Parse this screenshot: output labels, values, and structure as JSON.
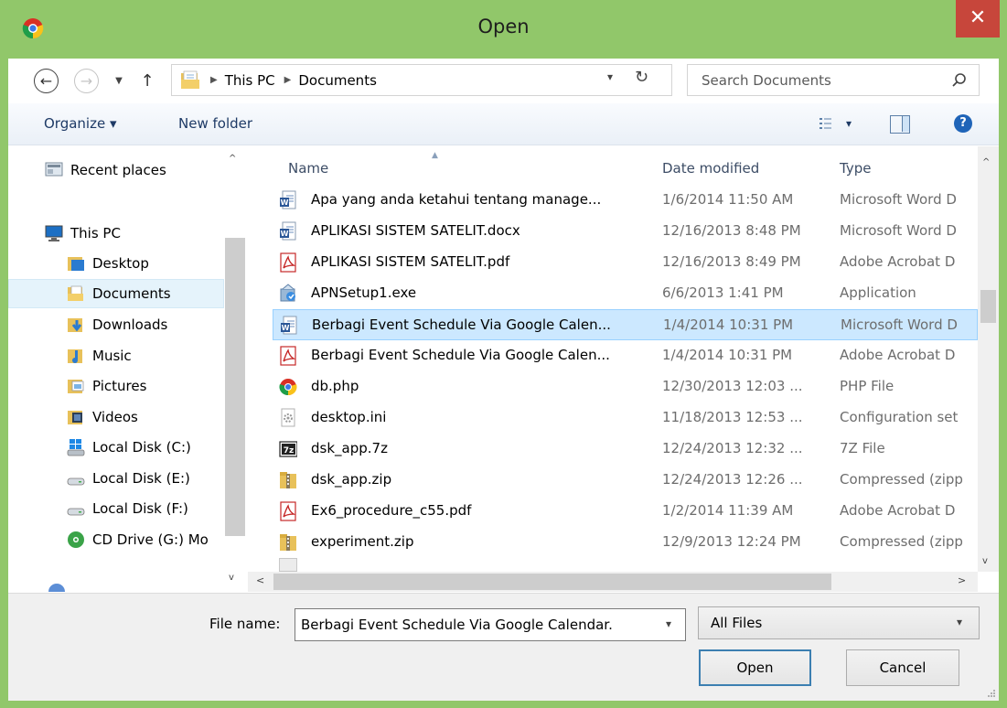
{
  "window": {
    "title": "Open",
    "close_glyph": "✕",
    "app_icon": "chrome-icon"
  },
  "navbar": {
    "back_glyph": "←",
    "forward_glyph": "→",
    "recent_glyph": "▼",
    "up_glyph": "↑",
    "breadcrumb": [
      "This PC",
      "Documents"
    ],
    "crumb_sep": "▶",
    "address_dropdown_glyph": "▾",
    "refresh_glyph": "↻"
  },
  "search": {
    "placeholder": "Search Documents",
    "icon": "search-icon"
  },
  "toolbar": {
    "organize_label": "Organize ▾",
    "new_folder_label": "New folder",
    "view_dropdown_glyph": "▾",
    "help_glyph": "?"
  },
  "nav_pane": {
    "scroll_up_glyph": "^",
    "scroll_down_glyph": "v",
    "items": [
      {
        "label": "Recent places",
        "icon": "recent-places-icon",
        "selected": false
      },
      {
        "label": "This PC",
        "icon": "this-pc-icon",
        "selected": false
      },
      {
        "label": "Desktop",
        "icon": "desktop-folder-icon",
        "selected": false
      },
      {
        "label": "Documents",
        "icon": "documents-folder-icon",
        "selected": true
      },
      {
        "label": "Downloads",
        "icon": "downloads-folder-icon",
        "selected": false
      },
      {
        "label": "Music",
        "icon": "music-folder-icon",
        "selected": false
      },
      {
        "label": "Pictures",
        "icon": "pictures-folder-icon",
        "selected": false
      },
      {
        "label": "Videos",
        "icon": "videos-folder-icon",
        "selected": false
      },
      {
        "label": "Local Disk (C:)",
        "icon": "windows-drive-icon",
        "selected": false
      },
      {
        "label": "Local Disk (E:)",
        "icon": "drive-icon",
        "selected": false
      },
      {
        "label": "Local Disk (F:)",
        "icon": "drive-icon",
        "selected": false
      },
      {
        "label": "CD Drive (G:) Mo",
        "icon": "cd-drive-icon",
        "selected": false
      }
    ]
  },
  "file_list": {
    "columns": {
      "name": "Name",
      "date": "Date modified",
      "type": "Type"
    },
    "sort_glyph": "▲",
    "scroll_up_glyph": "^",
    "scroll_down_glyph": "v",
    "scroll_left_glyph": "<",
    "scroll_right_glyph": ">",
    "rows": [
      {
        "name": "Apa yang anda ketahui tentang manage...",
        "date": "1/6/2014 11:50 AM",
        "type": "Microsoft Word D",
        "icon": "word-doc-icon",
        "selected": false
      },
      {
        "name": "APLIKASI SISTEM SATELIT.docx",
        "date": "12/16/2013 8:48 PM",
        "type": "Microsoft Word D",
        "icon": "word-doc-icon",
        "selected": false
      },
      {
        "name": "APLIKASI SISTEM SATELIT.pdf",
        "date": "12/16/2013 8:49 PM",
        "type": "Adobe Acrobat D",
        "icon": "pdf-icon",
        "selected": false
      },
      {
        "name": "APNSetup1.exe",
        "date": "6/6/2013 1:41 PM",
        "type": "Application",
        "icon": "setup-exe-icon",
        "selected": false
      },
      {
        "name": "Berbagi Event Schedule Via Google Calen...",
        "date": "1/4/2014 10:31 PM",
        "type": "Microsoft Word D",
        "icon": "word-doc-icon",
        "selected": true
      },
      {
        "name": "Berbagi Event Schedule Via Google Calen...",
        "date": "1/4/2014 10:31 PM",
        "type": "Adobe Acrobat D",
        "icon": "pdf-icon",
        "selected": false
      },
      {
        "name": "db.php",
        "date": "12/30/2013 12:03 ...",
        "type": "PHP File",
        "icon": "chrome-file-icon",
        "selected": false
      },
      {
        "name": "desktop.ini",
        "date": "11/18/2013 12:53 ...",
        "type": "Configuration set",
        "icon": "settings-file-icon",
        "selected": false
      },
      {
        "name": "dsk_app.7z",
        "date": "12/24/2013 12:32 ...",
        "type": "7Z File",
        "icon": "7zip-icon",
        "selected": false
      },
      {
        "name": "dsk_app.zip",
        "date": "12/24/2013 12:26 ...",
        "type": "Compressed (zipp",
        "icon": "zip-folder-icon",
        "selected": false
      },
      {
        "name": "Ex6_procedure_c55.pdf",
        "date": "1/2/2014 11:39 AM",
        "type": "Adobe Acrobat D",
        "icon": "pdf-icon",
        "selected": false
      },
      {
        "name": "experiment.zip",
        "date": "12/9/2013 12:24 PM",
        "type": "Compressed (zipp",
        "icon": "zip-folder-icon",
        "selected": false
      }
    ]
  },
  "bottom": {
    "file_name_label": "File name:",
    "file_name_value": "Berbagi Event Schedule Via Google Calendar.",
    "file_name_dropdown_glyph": "▾",
    "file_type_value": "All Files",
    "file_type_dropdown_glyph": "▾",
    "open_label": "Open",
    "cancel_label": "Cancel"
  },
  "colors": {
    "frame": "#91c76a",
    "close": "#c7463b",
    "selection": "#cce8ff",
    "nav_selection": "#e5f3fb"
  }
}
